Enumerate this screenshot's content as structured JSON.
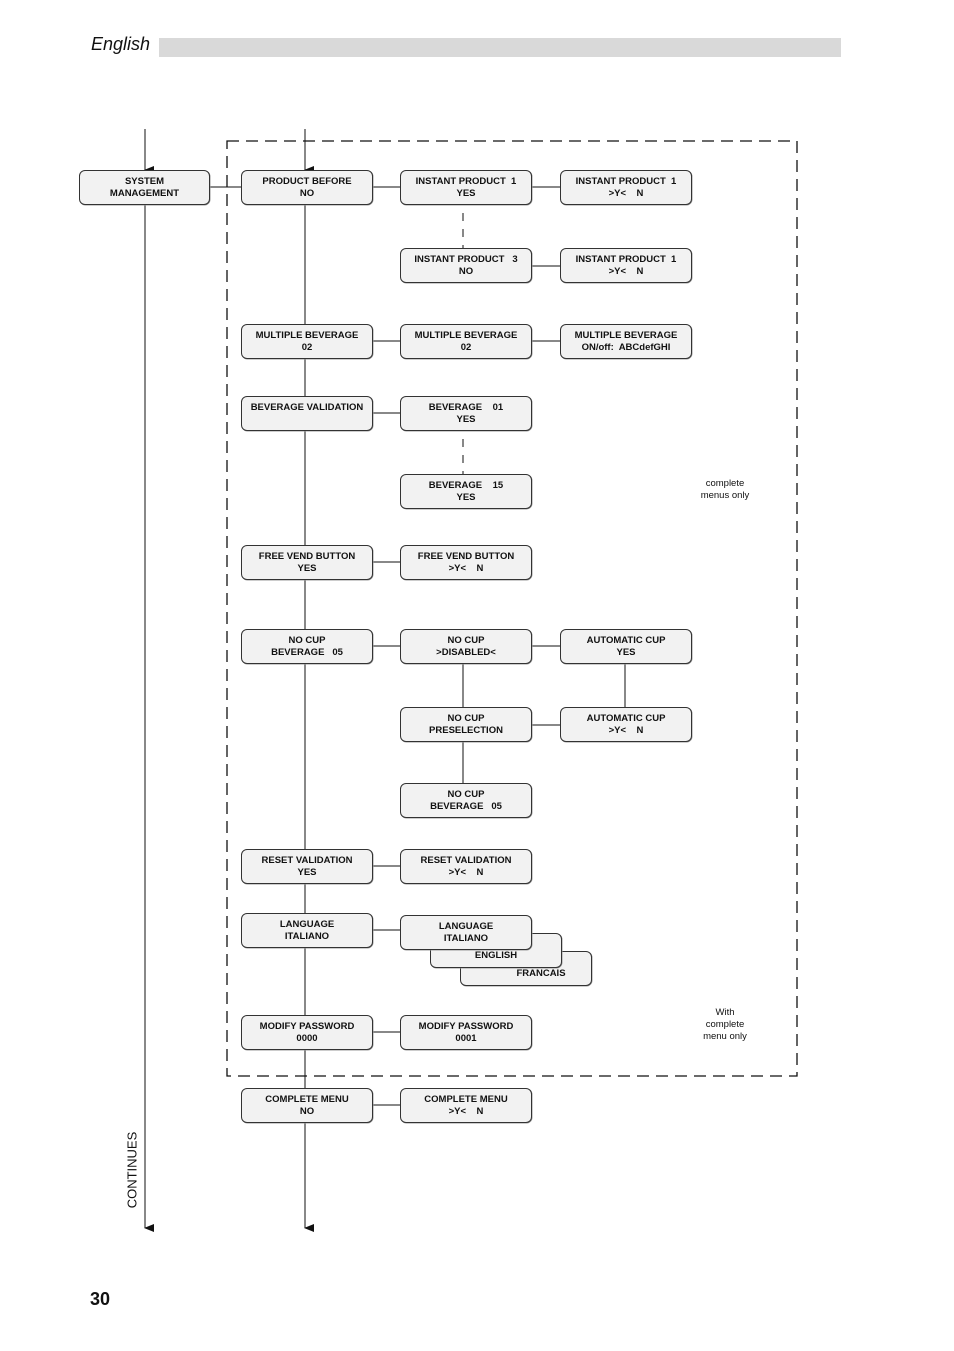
{
  "header": {
    "language": "English"
  },
  "page_number": "30",
  "continues_label": "CONTINUES",
  "notes": {
    "complete_menus_only": [
      "complete",
      "menus only"
    ],
    "with_complete_menu_only": [
      "With",
      "complete",
      "menu only"
    ]
  },
  "boxes": {
    "system_management": [
      "SYSTEM",
      "MANAGEMENT"
    ],
    "product_before": [
      "PRODUCT BEFORE",
      "NO"
    ],
    "instant_product_1": [
      "INSTANT PRODUCT  1",
      "YES"
    ],
    "instant_product_1_edit": [
      "INSTANT PRODUCT  1",
      ">Y<    N"
    ],
    "instant_product_3": [
      "INSTANT PRODUCT   3",
      "NO"
    ],
    "instant_product_3_edit": [
      "INSTANT PRODUCT  1",
      ">Y<    N"
    ],
    "multiple_beverage": [
      "MULTIPLE BEVERAGE",
      "02"
    ],
    "multiple_beverage_select": [
      "MULTIPLE BEVERAGE",
      "02"
    ],
    "multiple_beverage_edit": [
      "MULTIPLE BEVERAGE",
      "ON/off:  ABCdefGHI"
    ],
    "beverage_validation": [
      "BEVERAGE VALIDATION",
      ""
    ],
    "beverage_01": [
      "BEVERAGE    01",
      "YES"
    ],
    "beverage_15": [
      "BEVERAGE    15",
      "YES"
    ],
    "free_vend_button": [
      "FREE VEND BUTTON",
      "YES"
    ],
    "free_vend_button_edit": [
      "FREE VEND BUTTON",
      ">Y<    N"
    ],
    "no_cup_beverage": [
      "NO CUP",
      "BEVERAGE   05"
    ],
    "no_cup_disabled": [
      "NO CUP",
      ">DISABLED<"
    ],
    "automatic_cup": [
      "AUTOMATIC CUP",
      "YES"
    ],
    "no_cup_preselection": [
      "NO CUP",
      "PRESELECTION"
    ],
    "automatic_cup_edit": [
      "AUTOMATIC CUP",
      ">Y<    N"
    ],
    "no_cup_beverage_05": [
      "NO CUP",
      "BEVERAGE   05"
    ],
    "reset_validation": [
      "RESET VALIDATION",
      "YES"
    ],
    "reset_validation_edit": [
      "RESET VALIDATION",
      ">Y<    N"
    ],
    "language": [
      "LANGUAGE",
      "ITALIANO"
    ],
    "language_italiano": [
      "LANGUAGE",
      "ITALIANO"
    ],
    "language_english": [
      "",
      "ENGLISH"
    ],
    "language_francais": [
      "",
      "FRANCAIS"
    ],
    "modify_password": [
      "MODIFY PASSWORD",
      "0000"
    ],
    "modify_password_edit": [
      "MODIFY PASSWORD",
      "0001"
    ],
    "complete_menu": [
      "COMPLETE MENU",
      "NO"
    ],
    "complete_menu_edit": [
      "COMPLETE MENU",
      ">Y<    N"
    ]
  }
}
